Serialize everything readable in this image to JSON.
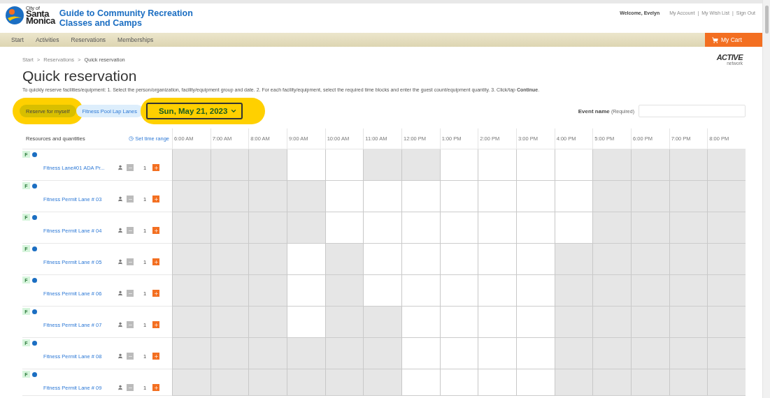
{
  "header": {
    "logo": {
      "small": "City of",
      "line1": "Santa",
      "line2": "Monica"
    },
    "title_lines": [
      "Guide to Community Recreation",
      "Classes and Camps"
    ],
    "welcome": "Welcome, Evelyn",
    "links": [
      "My Account",
      "My Wish List",
      "Sign Out"
    ],
    "separator": "|"
  },
  "nav": {
    "items": [
      {
        "label": "Start",
        "selected": false
      },
      {
        "label": "Activities",
        "selected": false
      },
      {
        "label": "Reservations",
        "selected": false
      },
      {
        "label": "Memberships",
        "selected": false
      }
    ],
    "cart": "My Cart"
  },
  "breadcrumb": {
    "items": [
      "Start",
      "Reservations",
      "Quick reservation"
    ],
    "separator": ">"
  },
  "brand": {
    "text": "ACTIVE",
    "subtext": "network"
  },
  "page_title": "Quick reservation",
  "instructions": "To quickly reserve facilities/equipment: 1. Select the person/organization, facility/equipment group and date. 2. For each facility/equipment, select the required time blocks and enter the guest count/equipment quantity. 3. Click/tap **Continue**.",
  "filters": {
    "person": {
      "label": "Reserve for myself",
      "highlighted": true
    },
    "group": {
      "label": "Fitness Pool Lap Lanes",
      "highlighted": false
    },
    "date": {
      "label": "Sun, May 21, 2023",
      "highlighted": true
    }
  },
  "event_name": {
    "label": "Event name",
    "hint": "(Required)"
  },
  "grid": {
    "resources_heading": "Resources and quantities",
    "time_range_link": "Set time range",
    "times": [
      "6:00 AM",
      "7:00 AM",
      "8:00 AM",
      "9:00 AM",
      "10:00 AM",
      "11:00 AM",
      "12:00 PM",
      "1:00 PM",
      "2:00 PM",
      "3:00 PM",
      "4:00 PM",
      "5:00 PM",
      "6:00 PM",
      "7:00 PM",
      "8:00 PM"
    ],
    "rows": [
      {
        "badge": "F",
        "name": "Fitness Lane#01 ADA Pr...",
        "quantity": "1",
        "slots": [
          false,
          false,
          false,
          true,
          true,
          false,
          false,
          true,
          true,
          true,
          true,
          false,
          false,
          false,
          false
        ]
      },
      {
        "badge": "F",
        "name": "Fitness Permit Lane # 03",
        "quantity": "1",
        "slots": [
          false,
          false,
          false,
          false,
          true,
          true,
          true,
          true,
          true,
          true,
          true,
          false,
          false,
          false,
          false
        ]
      },
      {
        "badge": "F",
        "name": "Fitness Permit Lane # 04",
        "quantity": "1",
        "slots": [
          false,
          false,
          false,
          false,
          true,
          true,
          true,
          true,
          true,
          true,
          true,
          false,
          false,
          false,
          false
        ]
      },
      {
        "badge": "F",
        "name": "Fitness Permit Lane # 05",
        "quantity": "1",
        "slots": [
          false,
          false,
          false,
          true,
          false,
          true,
          true,
          true,
          true,
          true,
          false,
          false,
          false,
          false,
          false
        ]
      },
      {
        "badge": "F",
        "name": "Fitness Permit Lane # 06",
        "quantity": "1",
        "slots": [
          false,
          false,
          false,
          true,
          false,
          true,
          true,
          true,
          true,
          true,
          false,
          false,
          false,
          false,
          false
        ]
      },
      {
        "badge": "F",
        "name": "Fitness Permit Lane # 07",
        "quantity": "1",
        "slots": [
          false,
          false,
          false,
          true,
          false,
          false,
          true,
          true,
          true,
          true,
          false,
          false,
          false,
          false,
          false
        ]
      },
      {
        "badge": "F",
        "name": "Fitness Permit Lane # 08",
        "quantity": "1",
        "slots": [
          false,
          false,
          false,
          false,
          false,
          false,
          true,
          true,
          true,
          true,
          false,
          false,
          false,
          false,
          false
        ]
      },
      {
        "badge": "F",
        "name": "Fitness Permit Lane # 09",
        "quantity": "1",
        "slots": [
          false,
          false,
          false,
          false,
          false,
          false,
          true,
          true,
          true,
          true,
          false,
          false,
          false,
          false,
          false
        ]
      }
    ]
  }
}
